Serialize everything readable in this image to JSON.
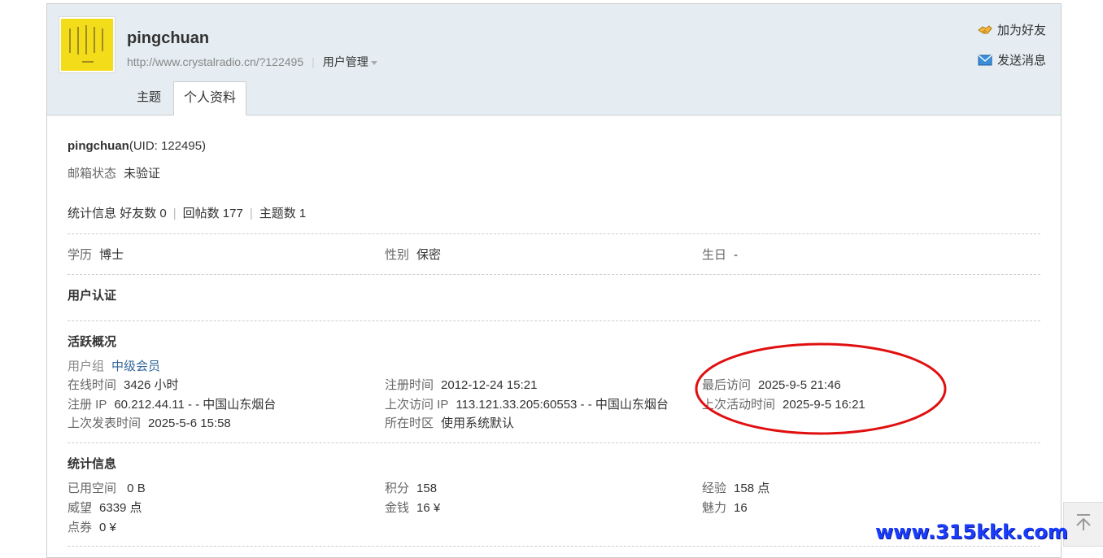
{
  "header": {
    "username": "pingchuan",
    "url": "http://www.crystalradio.cn/?122495",
    "user_manage": "用户管理",
    "add_friend": "加为好友",
    "send_message": "发送消息"
  },
  "tabs": [
    {
      "label": "主题",
      "active": false
    },
    {
      "label": "个人资料",
      "active": true
    }
  ],
  "profile": {
    "name": "pingchuan",
    "uid": "(UID: 122495)",
    "email_label": "邮箱状态",
    "email_value": "未验证",
    "stats_label": "统计信息",
    "friends": "好友数 0",
    "replies": "回帖数 177",
    "threads": "主题数 1",
    "education_label": "学历",
    "education_value": "博士",
    "gender_label": "性别",
    "gender_value": "保密",
    "birthday_label": "生日",
    "birthday_value": "-"
  },
  "verification": {
    "title": "用户认证"
  },
  "activity": {
    "title": "活跃概况",
    "group_label": "用户组",
    "group_value": "中级会员",
    "online_label": "在线时间",
    "online_value": "3426 小时",
    "reg_time_label": "注册时间",
    "reg_time_value": "2012-12-24 15:21",
    "last_visit_label": "最后访问",
    "last_visit_value": "2025-9-5 21:46",
    "reg_ip_label": "注册 IP",
    "reg_ip_value": "60.212.44.11 - - 中国山东烟台",
    "last_ip_label": "上次访问 IP",
    "last_ip_value": "113.121.33.205:60553 - - 中国山东烟台",
    "last_active_label": "上次活动时间",
    "last_active_value": "2025-9-5 16:21",
    "last_post_label": "上次发表时间",
    "last_post_value": "2025-5-6 15:58",
    "timezone_label": "所在时区",
    "timezone_value": "使用系统默认"
  },
  "statistics": {
    "title": "统计信息",
    "space_label": "已用空间",
    "space_value": " 0 B",
    "points_label": "积分",
    "points_value": "158",
    "exp_label": "经验",
    "exp_value": "158 点",
    "prestige_label": "威望",
    "prestige_value": "6339 点",
    "money_label": "金钱",
    "money_value": "16 ¥",
    "charm_label": "魅力",
    "charm_value": "16",
    "coupon_label": "点券",
    "coupon_value": "0 ¥"
  },
  "watermark": "www.315kkk.com",
  "colors": {
    "header_bg": "#e5edf2",
    "annotation": "#e01010",
    "watermark": "#1a3cff",
    "link_blue": "#336699"
  }
}
